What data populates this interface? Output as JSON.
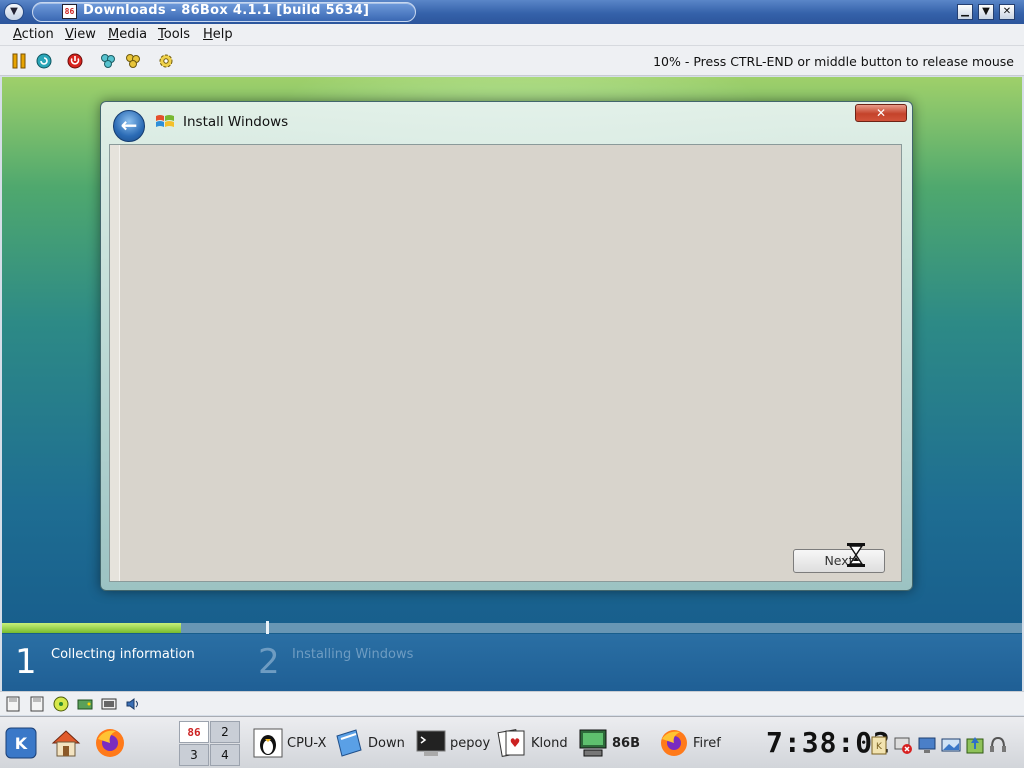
{
  "window": {
    "title": "Downloads - 86Box 4.1.1 [build 5634]",
    "app_icon_text": "86",
    "controls": [
      "minimize",
      "maximize",
      "close"
    ]
  },
  "menubar": {
    "items": [
      "Action",
      "View",
      "Media",
      "Tools",
      "Help"
    ]
  },
  "toolbar": {
    "icons": [
      "pause-icon",
      "reset-icon",
      "power-icon",
      "ctrl-alt-del-icon",
      "ctrl-alt-esc-icon",
      "settings-icon"
    ],
    "status_hint": "10% - Press CTRL-END or middle button to release mouse"
  },
  "emulator_screen": {
    "installer": {
      "title": "Install Windows",
      "close_symbol": "✕",
      "back_symbol": "←",
      "next_button": "Next",
      "progress_fraction": 0.175,
      "steps": [
        {
          "number": "1",
          "label": "Collecting information",
          "state": "active"
        },
        {
          "number": "2",
          "label": "Installing Windows",
          "state": "inactive"
        }
      ]
    }
  },
  "statusbar": {
    "icons": [
      "floppy-a-icon",
      "floppy-b-icon",
      "cdrom-icon",
      "hard-disk-icon",
      "network-icon",
      "sound-icon"
    ]
  },
  "taskbar": {
    "launchers": [
      "kde-menu-icon",
      "home-icon",
      "firefox-icon"
    ],
    "pager": [
      "2",
      "3",
      "4"
    ],
    "pager_active_icon": "86",
    "tasks": [
      {
        "label": "CPU-X",
        "icon": "tux-icon"
      },
      {
        "label": "Down",
        "icon": "dolphin-icon"
      },
      {
        "label": "pepoy",
        "icon": "terminal-icon"
      },
      {
        "label": "Klond",
        "icon": "cards-icon"
      },
      {
        "label": "86B",
        "icon": "86box-icon"
      },
      {
        "label": "Firef",
        "icon": "firefox-icon"
      }
    ],
    "clock": "7:38:02",
    "tray": [
      "klipper-icon",
      "network-error-icon",
      "display-icon",
      "screen-icon",
      "update-icon",
      "headset-icon"
    ]
  },
  "colors": {
    "titlebar": "#3562aa",
    "progress_fill": "#78bc2e",
    "step_active": "#ffffff",
    "step_inactive": "#6e9cc2"
  }
}
